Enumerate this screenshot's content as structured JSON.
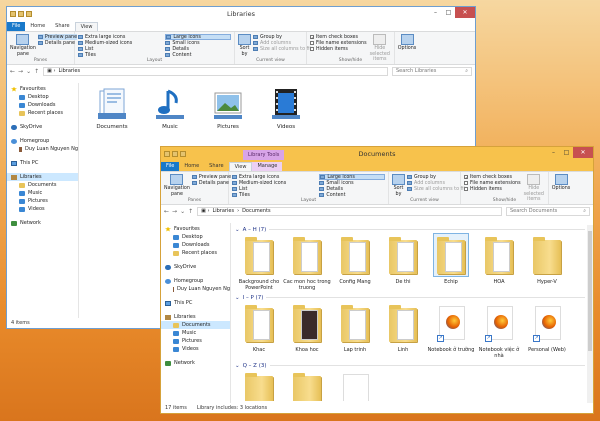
{
  "win1": {
    "title": "Libraries",
    "tabs": [
      "File",
      "Home",
      "Share",
      "View"
    ],
    "ribbon": {
      "panes": {
        "nav_pane": "Navigation pane",
        "preview_pane": "Preview pane",
        "details_pane": "Details pane",
        "label": "Panes"
      },
      "layout": {
        "items": [
          "Extra large icons",
          "Large icons",
          "Medium-sized icons",
          "Small icons",
          "List",
          "Details",
          "Tiles",
          "Content"
        ],
        "label": "Layout"
      },
      "current_view": {
        "sort_by": "Sort by",
        "group_by": "Group by",
        "add_columns": "Add columns",
        "size_columns": "Size all columns to fit",
        "label": "Current view"
      },
      "show_hide": {
        "item_checkboxes": "Item check boxes",
        "file_ext": "File name extensions",
        "hidden_items": "Hidden items",
        "hide_selected": "Hide selected items",
        "label": "Show/hide"
      },
      "options": "Options"
    },
    "address": {
      "path": "Libraries",
      "search_placeholder": "Search Libraries"
    },
    "nav": {
      "favourites": "Favourites",
      "desktop": "Desktop",
      "downloads": "Downloads",
      "recent": "Recent places",
      "skydrive": "SkyDrive",
      "homegroup": "Homegroup",
      "user": "Duy Luan Nguyen Ng",
      "thispc": "This PC",
      "libraries": "Libraries",
      "documents": "Documents",
      "music": "Music",
      "pictures": "Pictures",
      "videos": "Videos",
      "network": "Network"
    },
    "items": [
      "Documents",
      "Music",
      "Pictures",
      "Videos"
    ],
    "status": "4 items"
  },
  "win2": {
    "title": "Documents",
    "library_tools": "Library Tools",
    "tabs": [
      "File",
      "Home",
      "Share",
      "View",
      "Manage"
    ],
    "ribbon": {
      "panes": {
        "nav_pane": "Navigation pane",
        "preview_pane": "Preview pane",
        "details_pane": "Details pane",
        "label": "Panes"
      },
      "layout": {
        "items": [
          "Extra large icons",
          "Large icons",
          "Medium-sized icons",
          "Small icons",
          "List",
          "Details",
          "Tiles",
          "Content"
        ],
        "label": "Layout"
      },
      "current_view": {
        "sort_by": "Sort by",
        "group_by": "Group by",
        "add_columns": "Add columns",
        "size_columns": "Size all columns to fit",
        "label": "Current view"
      },
      "show_hide": {
        "item_checkboxes": "Item check boxes",
        "file_ext": "File name extensions",
        "hidden_items": "Hidden items",
        "hide_selected": "Hide selected items",
        "label": "Show/hide"
      },
      "options": "Options"
    },
    "address": {
      "path1": "Libraries",
      "path2": "Documents",
      "search_placeholder": "Search Documents"
    },
    "nav": {
      "favourites": "Favourites",
      "desktop": "Desktop",
      "downloads": "Downloads",
      "recent": "Recent places",
      "skydrive": "SkyDrive",
      "homegroup": "Homegroup",
      "user": "Duy Luan Nguyen Ng",
      "thispc": "This PC",
      "libraries": "Libraries",
      "documents": "Documents",
      "music": "Music",
      "pictures": "Pictures",
      "videos": "Videos",
      "network": "Network"
    },
    "groups": [
      {
        "header": "A – H (7)",
        "items": [
          "Background cho PowerPoint",
          "Cac mon hoc trong truong",
          "Config Mang",
          "De thi",
          "Echip",
          "HOA",
          "Hyper-V"
        ]
      },
      {
        "header": "I – P (7)",
        "items": [
          "Khac",
          "Khoa hoc",
          "Lap trinh",
          "Linh",
          "Notebook ở trường",
          "Notebook việc ở nhà",
          "Personal (Web)"
        ]
      },
      {
        "header": "Q – Z (3)",
        "items": []
      }
    ],
    "status": {
      "count": "17 items",
      "library": "Library includes: 3 locations"
    }
  }
}
